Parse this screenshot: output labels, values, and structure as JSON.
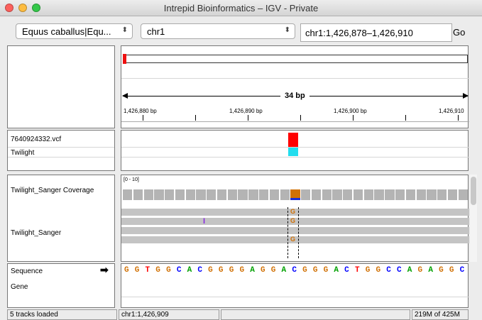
{
  "window": {
    "title": "Intrepid Bioinformatics – IGV - Private"
  },
  "toolbar": {
    "genome_label": "Equus caballus|Equ...",
    "chromosome_label": "chr1",
    "locus_value": "chr1:1,426,878–1,426,910",
    "go_label": "Go"
  },
  "ruler": {
    "span_label": "34 bp",
    "ticks": [
      "1,426,880 bp",
      "1,426,890 bp",
      "1,426,900 bp",
      "1,426,910"
    ]
  },
  "vcf_panel": {
    "track1": "7640924332.vcf",
    "track2": "Twilight"
  },
  "alignment_panel": {
    "coverage_name": "Twilight_Sanger Coverage",
    "coverage_range": "[0 - 10]",
    "alignments_name": "Twilight_Sanger",
    "mismatch_base": "G"
  },
  "feature_panel": {
    "sequence_label": "Sequence",
    "gene_label": "Gene",
    "sequence": [
      "G",
      "G",
      "T",
      "G",
      "G",
      "C",
      "A",
      "C",
      "G",
      "G",
      "G",
      "G",
      "A",
      "G",
      "G",
      "A",
      "C",
      "G",
      "G",
      "G",
      "A",
      "C",
      "T",
      "G",
      "G",
      "C",
      "C",
      "A",
      "G",
      "A",
      "G",
      "G",
      "C"
    ]
  },
  "status_bar": {
    "tracks_loaded": "5 tracks loaded",
    "position": "chr1:1,426,909",
    "memory": "219M of 425M"
  },
  "colors": {
    "base_A": "#00a000",
    "base_C": "#0000ff",
    "base_G": "#d17105",
    "base_T": "#ff0000",
    "variant": "#ff0000",
    "genotype": "#22ccee"
  }
}
